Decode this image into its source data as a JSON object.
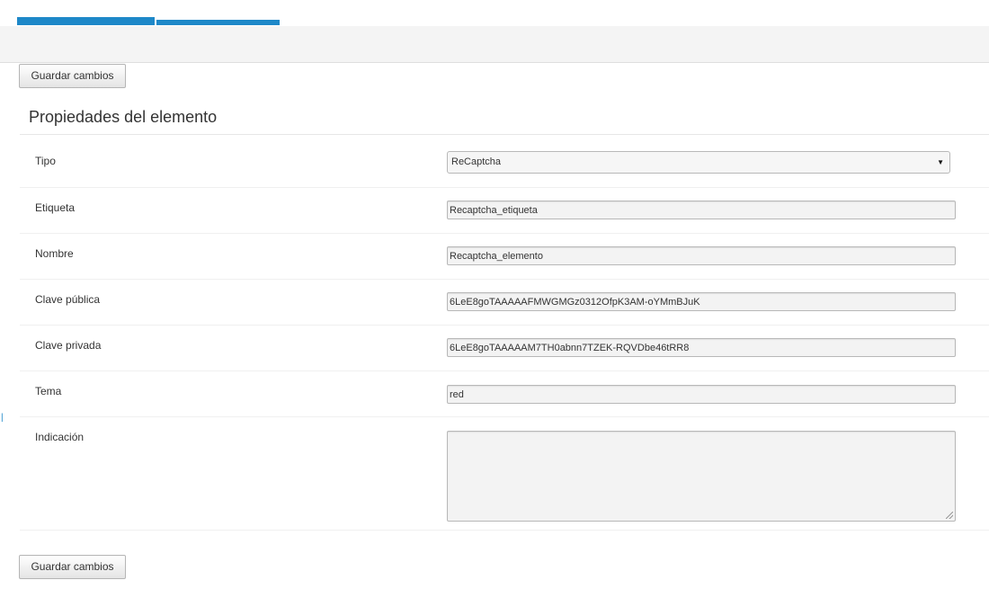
{
  "toolbar": {
    "save_label": "Guardar cambios"
  },
  "section": {
    "title": "Propiedades del elemento"
  },
  "fields": {
    "tipo": {
      "label": "Tipo",
      "value": "ReCaptcha"
    },
    "etiqueta": {
      "label": "Etiqueta",
      "value": "Recaptcha_etiqueta"
    },
    "nombre": {
      "label": "Nombre",
      "value": "Recaptcha_elemento"
    },
    "clave_publica": {
      "label": "Clave pública",
      "value": "6LeE8goTAAAAAFMWGMGz0312OfpK3AM-oYMmBJuK"
    },
    "clave_privada": {
      "label": "Clave privada",
      "value": "6LeE8goTAAAAAM7TH0abnn7TZEK-RQVDbe46tRR8"
    },
    "tema": {
      "label": "Tema",
      "value": "red"
    },
    "indicacion": {
      "label": "Indicación",
      "value": ""
    }
  },
  "footer": {
    "save_label": "Guardar cambios"
  },
  "icons": {
    "select_caret": "chevron-down-icon",
    "resize_grip": "resize-grip-icon"
  },
  "colors": {
    "accent": "#1e88c8",
    "toolbar_bg": "#f4f4f4",
    "field_bg": "#f3f3f3"
  }
}
